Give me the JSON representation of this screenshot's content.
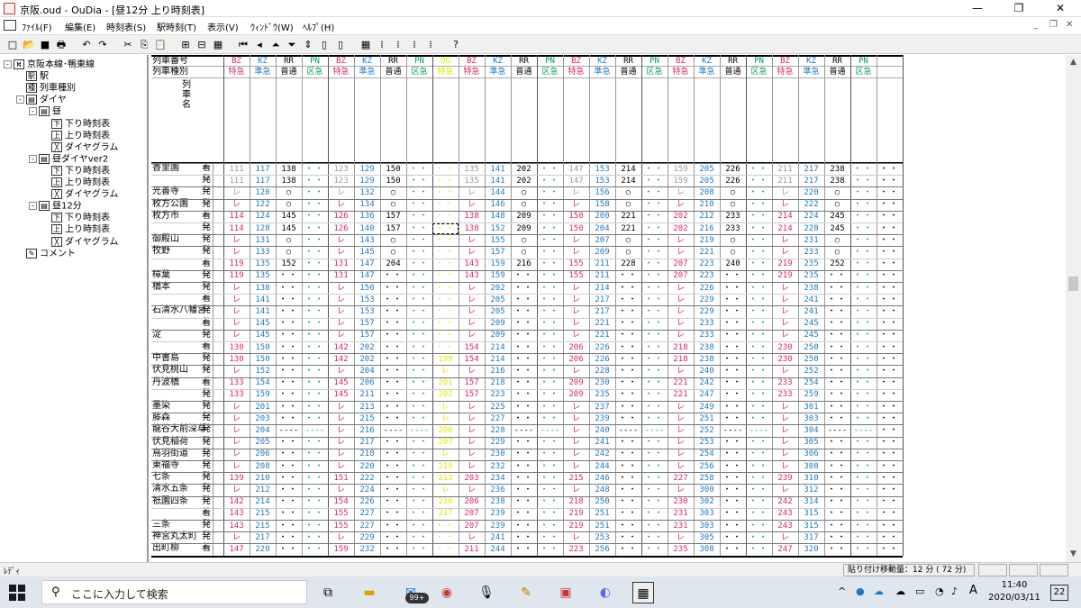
{
  "window": {
    "title": "京阪.oud - OuDia - [昼12分 上り時刻表]",
    "minimize": "—",
    "maximize": "❐",
    "close": "✕"
  },
  "menu": [
    "ﾌｧｲﾙ(F)",
    "編集(E)",
    "時刻表(S)",
    "駅時刻(T)",
    "表示(V)",
    "ｳｨﾝﾄﾞｳ(W)",
    "ﾍﾙﾌﾟ(H)"
  ],
  "mdi_controls": [
    "_",
    "❐",
    "✕"
  ],
  "toolbar_icons": [
    "new-file-icon",
    "open-folder-icon",
    "save-icon",
    "print-icon",
    "undo-icon",
    "redo-icon",
    "cut-icon",
    "copy-icon",
    "paste-icon",
    "insert-train-icon",
    "delete-train-icon",
    "grid-icon",
    "first-icon",
    "prev-icon",
    "time-up-icon",
    "time-down-icon",
    "time-shift-icon",
    "col-left-icon",
    "col-right-icon",
    "timetable-icon",
    "pattern1-icon",
    "pattern2-icon",
    "pattern3-icon",
    "pattern4-icon",
    "help-icon"
  ],
  "tree": [
    {
      "label": "京阪本線･鴨東線",
      "icon": "route-icon",
      "level": 0,
      "exp": "-"
    },
    {
      "label": "駅",
      "icon": "station-icon",
      "level": 1
    },
    {
      "label": "列車種別",
      "icon": "train-type-icon",
      "level": 1
    },
    {
      "label": "ダイヤ",
      "icon": "dia-icon",
      "level": 1,
      "exp": "-"
    },
    {
      "label": "昼",
      "icon": "dia-icon",
      "level": 2,
      "exp": "-"
    },
    {
      "label": "下り時刻表",
      "icon": "down-timetable-icon",
      "level": 3
    },
    {
      "label": "上り時刻表",
      "icon": "up-timetable-icon",
      "level": 3
    },
    {
      "label": "ダイヤグラム",
      "icon": "diagram-icon",
      "level": 3
    },
    {
      "label": "昼ダイヤver2",
      "icon": "dia-icon",
      "level": 2,
      "exp": "-"
    },
    {
      "label": "下り時刻表",
      "icon": "down-timetable-icon",
      "level": 3
    },
    {
      "label": "上り時刻表",
      "icon": "up-timetable-icon",
      "level": 3
    },
    {
      "label": "ダイヤグラム",
      "icon": "diagram-icon",
      "level": 3
    },
    {
      "label": "昼12分",
      "icon": "dia-icon",
      "level": 2,
      "exp": "-"
    },
    {
      "label": "下り時刻表",
      "icon": "down-timetable-icon",
      "level": 3
    },
    {
      "label": "上り時刻表",
      "icon": "up-timetable-icon",
      "level": 3
    },
    {
      "label": "ダイヤグラム",
      "icon": "diagram-icon",
      "level": 3
    },
    {
      "label": "コメント",
      "icon": "comment-icon",
      "level": 1
    }
  ],
  "colors": {
    "BZ": "#e0245e",
    "KZ": "#1e78c8",
    "RR": "#000000",
    "PN": "#00a050",
    "Y": "#e6e600"
  },
  "header": {
    "train_number": "列車番号",
    "train_type": "列車種別",
    "train_name": "列車名"
  },
  "trains": [
    {
      "no": "BZ",
      "type": "特急",
      "c": "BZ"
    },
    {
      "no": "KZ",
      "type": "準急",
      "c": "KZ"
    },
    {
      "no": "RR",
      "type": "普通",
      "c": "RR"
    },
    {
      "no": "PN",
      "type": "区急",
      "c": "PN"
    },
    {
      "no": "BZ",
      "type": "特急",
      "c": "BZ"
    },
    {
      "no": "KZ",
      "type": "準急",
      "c": "KZ"
    },
    {
      "no": "RR",
      "type": "普通",
      "c": "RR"
    },
    {
      "no": "PN",
      "type": "区急",
      "c": "PN"
    },
    {
      "no": "OG",
      "type": "特急",
      "c": "Y"
    },
    {
      "no": "BZ",
      "type": "特急",
      "c": "BZ"
    },
    {
      "no": "KZ",
      "type": "準急",
      "c": "KZ"
    },
    {
      "no": "RR",
      "type": "普通",
      "c": "RR"
    },
    {
      "no": "PN",
      "type": "区急",
      "c": "PN"
    },
    {
      "no": "BZ",
      "type": "特急",
      "c": "BZ"
    },
    {
      "no": "KZ",
      "type": "準急",
      "c": "KZ"
    },
    {
      "no": "RR",
      "type": "普通",
      "c": "RR"
    },
    {
      "no": "PN",
      "type": "区急",
      "c": "PN"
    },
    {
      "no": "BZ",
      "type": "特急",
      "c": "BZ"
    },
    {
      "no": "KZ",
      "type": "準急",
      "c": "KZ"
    },
    {
      "no": "RR",
      "type": "普通",
      "c": "RR"
    },
    {
      "no": "PN",
      "type": "区急",
      "c": "PN"
    },
    {
      "no": "BZ",
      "type": "特急",
      "c": "BZ"
    },
    {
      "no": "KZ",
      "type": "準急",
      "c": "KZ"
    },
    {
      "no": "RR",
      "type": "普通",
      "c": "RR"
    },
    {
      "no": "PN",
      "type": "区急",
      "c": "PN"
    },
    {
      "no": "",
      "type": "",
      "c": "RR"
    }
  ],
  "rows": [
    {
      "st": "香里園",
      "kb": "着",
      "v": [
        "111",
        "117",
        "138",
        "・・",
        "123",
        "129",
        "150",
        "・・",
        "・・",
        "135",
        "141",
        "202",
        "・・",
        "147",
        "153",
        "214",
        "・・",
        "159",
        "205",
        "226",
        "・・",
        "211",
        "217",
        "238",
        "・・",
        "・・"
      ]
    },
    {
      "st": "",
      "kb": "発",
      "v": [
        "111",
        "117",
        "138",
        "・・",
        "123",
        "129",
        "150",
        "・・",
        "・・",
        "135",
        "141",
        "202",
        "・・",
        "147",
        "153",
        "214",
        "・・",
        "159",
        "205",
        "226",
        "・・",
        "211",
        "217",
        "238",
        "・・",
        "・・"
      ]
    },
    {
      "st": "光善寺",
      "kb": "発",
      "v": [
        "レ",
        "120",
        "○",
        "・・",
        "レ",
        "132",
        "○",
        "・・",
        "・・",
        "レ",
        "144",
        "○",
        "・・",
        "レ",
        "156",
        "○",
        "・・",
        "レ",
        "208",
        "○",
        "・・",
        "レ",
        "220",
        "○",
        "・・",
        "・・"
      ]
    },
    {
      "st": "枚方公園",
      "kb": "発",
      "v": [
        "レ",
        "122",
        "○",
        "・・",
        "レ",
        "134",
        "○",
        "・・",
        "・・",
        "レ",
        "146",
        "○",
        "・・",
        "レ",
        "158",
        "○",
        "・・",
        "レ",
        "210",
        "○",
        "・・",
        "レ",
        "222",
        "○",
        "・・",
        "・・"
      ]
    },
    {
      "st": "枚方市",
      "kb": "着",
      "v": [
        "114",
        "124",
        "145",
        "・・",
        "126",
        "136",
        "157",
        "・・",
        "・・",
        "138",
        "148",
        "209",
        "・・",
        "150",
        "200",
        "221",
        "・・",
        "202",
        "212",
        "233",
        "・・",
        "214",
        "224",
        "245",
        "・・",
        "・・"
      ]
    },
    {
      "st": "",
      "kb": "発",
      "v": [
        "114",
        "128",
        "145",
        "・・",
        "126",
        "140",
        "157",
        "・・",
        "・・",
        "138",
        "152",
        "209",
        "・・",
        "150",
        "204",
        "221",
        "・・",
        "202",
        "216",
        "233",
        "・・",
        "214",
        "228",
        "245",
        "・・",
        "・・"
      ]
    },
    {
      "st": "御殿山",
      "kb": "発",
      "v": [
        "レ",
        "131",
        "○",
        "・・",
        "レ",
        "143",
        "○",
        "・・",
        "・・",
        "レ",
        "155",
        "○",
        "・・",
        "レ",
        "207",
        "○",
        "・・",
        "レ",
        "219",
        "○",
        "・・",
        "レ",
        "231",
        "○",
        "・・",
        "・・"
      ]
    },
    {
      "st": "牧野",
      "kb": "発",
      "v": [
        "レ",
        "133",
        "○",
        "・・",
        "レ",
        "145",
        "○",
        "・・",
        "・・",
        "レ",
        "157",
        "○",
        "・・",
        "レ",
        "209",
        "○",
        "・・",
        "レ",
        "221",
        "○",
        "・・",
        "レ",
        "233",
        "○",
        "・・",
        "・・"
      ]
    },
    {
      "st": "",
      "kb": "着",
      "v": [
        "119",
        "135",
        "152",
        "・・",
        "131",
        "147",
        "204",
        "・・",
        "・・",
        "143",
        "159",
        "216",
        "・・",
        "155",
        "211",
        "228",
        "・・",
        "207",
        "223",
        "240",
        "・・",
        "219",
        "235",
        "252",
        "・・",
        "・・"
      ]
    },
    {
      "st": "樟葉",
      "kb": "発",
      "v": [
        "119",
        "135",
        "・・",
        "・・",
        "131",
        "147",
        "・・",
        "・・",
        "・・",
        "143",
        "159",
        "・・",
        "・・",
        "155",
        "211",
        "・・",
        "・・",
        "207",
        "223",
        "・・",
        "・・",
        "219",
        "235",
        "・・",
        "・・",
        "・・"
      ]
    },
    {
      "st": "橋本",
      "kb": "発",
      "v": [
        "レ",
        "138",
        "・・",
        "・・",
        "レ",
        "150",
        "・・",
        "・・",
        "・・",
        "レ",
        "202",
        "・・",
        "・・",
        "レ",
        "214",
        "・・",
        "・・",
        "レ",
        "226",
        "・・",
        "・・",
        "レ",
        "238",
        "・・",
        "・・",
        "・・"
      ]
    },
    {
      "st": "",
      "kb": "着",
      "v": [
        "レ",
        "141",
        "・・",
        "・・",
        "レ",
        "153",
        "・・",
        "・・",
        "・・",
        "レ",
        "205",
        "・・",
        "・・",
        "レ",
        "217",
        "・・",
        "・・",
        "レ",
        "229",
        "・・",
        "・・",
        "レ",
        "241",
        "・・",
        "・・",
        "・・"
      ]
    },
    {
      "st": "石清水八幡宮",
      "kb": "発",
      "v": [
        "レ",
        "141",
        "・・",
        "・・",
        "レ",
        "153",
        "・・",
        "・・",
        "・・",
        "レ",
        "205",
        "・・",
        "・・",
        "レ",
        "217",
        "・・",
        "・・",
        "レ",
        "229",
        "・・",
        "・・",
        "レ",
        "241",
        "・・",
        "・・",
        "・・"
      ]
    },
    {
      "st": "",
      "kb": "着",
      "v": [
        "レ",
        "145",
        "・・",
        "・・",
        "レ",
        "157",
        "・・",
        "・・",
        "・・",
        "レ",
        "209",
        "・・",
        "・・",
        "レ",
        "221",
        "・・",
        "・・",
        "レ",
        "233",
        "・・",
        "・・",
        "レ",
        "245",
        "・・",
        "・・",
        "・・"
      ]
    },
    {
      "st": "淀",
      "kb": "発",
      "v": [
        "レ",
        "145",
        "・・",
        "・・",
        "レ",
        "157",
        "・・",
        "・・",
        "・・",
        "レ",
        "209",
        "・・",
        "・・",
        "レ",
        "221",
        "・・",
        "・・",
        "レ",
        "233",
        "・・",
        "・・",
        "レ",
        "245",
        "・・",
        "・・",
        "・・"
      ]
    },
    {
      "st": "",
      "kb": "着",
      "v": [
        "130",
        "150",
        "・・",
        "・・",
        "142",
        "202",
        "・・",
        "・・",
        "・・",
        "154",
        "214",
        "・・",
        "・・",
        "206",
        "226",
        "・・",
        "・・",
        "218",
        "238",
        "・・",
        "・・",
        "230",
        "250",
        "・・",
        "・・",
        "・・"
      ]
    },
    {
      "st": "中書島",
      "kb": "発",
      "v": [
        "130",
        "150",
        "・・",
        "・・",
        "142",
        "202",
        "・・",
        "・・",
        "199",
        "154",
        "214",
        "・・",
        "・・",
        "206",
        "226",
        "・・",
        "・・",
        "218",
        "238",
        "・・",
        "・・",
        "230",
        "250",
        "・・",
        "・・",
        "・・"
      ]
    },
    {
      "st": "伏見桃山",
      "kb": "発",
      "v": [
        "レ",
        "152",
        "・・",
        "・・",
        "レ",
        "204",
        "・・",
        "・・",
        "レ",
        "レ",
        "216",
        "・・",
        "・・",
        "レ",
        "228",
        "・・",
        "・・",
        "レ",
        "240",
        "・・",
        "・・",
        "レ",
        "252",
        "・・",
        "・・",
        "・・"
      ]
    },
    {
      "st": "丹波橋",
      "kb": "着",
      "v": [
        "133",
        "154",
        "・・",
        "・・",
        "145",
        "206",
        "・・",
        "・・",
        "201",
        "157",
        "218",
        "・・",
        "・・",
        "209",
        "230",
        "・・",
        "・・",
        "221",
        "242",
        "・・",
        "・・",
        "233",
        "254",
        "・・",
        "・・",
        "・・"
      ]
    },
    {
      "st": "",
      "kb": "発",
      "v": [
        "133",
        "159",
        "・・",
        "・・",
        "145",
        "211",
        "・・",
        "・・",
        "202",
        "157",
        "223",
        "・・",
        "・・",
        "209",
        "235",
        "・・",
        "・・",
        "221",
        "247",
        "・・",
        "・・",
        "233",
        "259",
        "・・",
        "・・",
        "・・"
      ]
    },
    {
      "st": "墨染",
      "kb": "発",
      "v": [
        "レ",
        "201",
        "・・",
        "・・",
        "レ",
        "213",
        "・・",
        "・・",
        "レ",
        "レ",
        "225",
        "・・",
        "・・",
        "レ",
        "237",
        "・・",
        "・・",
        "レ",
        "249",
        "・・",
        "・・",
        "レ",
        "301",
        "・・",
        "・・",
        "・・"
      ]
    },
    {
      "st": "藤森",
      "kb": "発",
      "v": [
        "レ",
        "203",
        "・・",
        "・・",
        "レ",
        "215",
        "・・",
        "・・",
        "レ",
        "レ",
        "227",
        "・・",
        "・・",
        "レ",
        "239",
        "・・",
        "・・",
        "レ",
        "251",
        "・・",
        "・・",
        "レ",
        "303",
        "・・",
        "・・",
        "・・"
      ]
    },
    {
      "st": "龍谷大前深草",
      "kb": "発",
      "v": [
        "レ",
        "204",
        "----",
        "----",
        "レ",
        "216",
        "----",
        "----",
        "206",
        "レ",
        "228",
        "----",
        "----",
        "レ",
        "240",
        "----",
        "----",
        "レ",
        "252",
        "----",
        "----",
        "レ",
        "304",
        "----",
        "----",
        "・・"
      ]
    },
    {
      "st": "伏見稲荷",
      "kb": "発",
      "v": [
        "レ",
        "205",
        "・・",
        "・・",
        "レ",
        "217",
        "・・",
        "・・",
        "207",
        "レ",
        "229",
        "・・",
        "・・",
        "レ",
        "241",
        "・・",
        "・・",
        "レ",
        "253",
        "・・",
        "・・",
        "レ",
        "305",
        "・・",
        "・・",
        "・・"
      ]
    },
    {
      "st": "鳥羽街道",
      "kb": "発",
      "v": [
        "レ",
        "206",
        "・・",
        "・・",
        "レ",
        "218",
        "・・",
        "・・",
        "レ",
        "レ",
        "230",
        "・・",
        "・・",
        "レ",
        "242",
        "・・",
        "・・",
        "レ",
        "254",
        "・・",
        "・・",
        "レ",
        "306",
        "・・",
        "・・",
        "・・"
      ]
    },
    {
      "st": "東福寺",
      "kb": "発",
      "v": [
        "レ",
        "208",
        "・・",
        "・・",
        "レ",
        "220",
        "・・",
        "・・",
        "210",
        "レ",
        "232",
        "・・",
        "・・",
        "レ",
        "244",
        "・・",
        "・・",
        "レ",
        "256",
        "・・",
        "・・",
        "レ",
        "308",
        "・・",
        "・・",
        "・・"
      ]
    },
    {
      "st": "七条",
      "kb": "発",
      "v": [
        "139",
        "210",
        "・・",
        "・・",
        "151",
        "222",
        "・・",
        "・・",
        "213",
        "203",
        "234",
        "・・",
        "・・",
        "215",
        "246",
        "・・",
        "・・",
        "227",
        "258",
        "・・",
        "・・",
        "239",
        "310",
        "・・",
        "・・",
        "・・"
      ]
    },
    {
      "st": "清水五条",
      "kb": "発",
      "v": [
        "レ",
        "212",
        "・・",
        "・・",
        "レ",
        "224",
        "・・",
        "・・",
        "レ",
        "レ",
        "236",
        "・・",
        "・・",
        "レ",
        "248",
        "・・",
        "・・",
        "レ",
        "300",
        "・・",
        "・・",
        "レ",
        "312",
        "・・",
        "・・",
        "・・"
      ]
    },
    {
      "st": "祇園四条",
      "kb": "発",
      "v": [
        "142",
        "214",
        "・・",
        "・・",
        "154",
        "226",
        "・・",
        "・・",
        "216",
        "206",
        "238",
        "・・",
        "・・",
        "218",
        "250",
        "・・",
        "・・",
        "230",
        "302",
        "・・",
        "・・",
        "242",
        "314",
        "・・",
        "・・",
        "・・"
      ]
    },
    {
      "st": "",
      "kb": "着",
      "v": [
        "143",
        "215",
        "・・",
        "・・",
        "155",
        "227",
        "・・",
        "・・",
        "217",
        "207",
        "239",
        "・・",
        "・・",
        "219",
        "251",
        "・・",
        "・・",
        "231",
        "303",
        "・・",
        "・・",
        "243",
        "315",
        "・・",
        "・・",
        "・・"
      ]
    },
    {
      "st": "三条",
      "kb": "発",
      "v": [
        "143",
        "215",
        "・・",
        "・・",
        "155",
        "227",
        "・・",
        "・・",
        "・・",
        "207",
        "239",
        "・・",
        "・・",
        "219",
        "251",
        "・・",
        "・・",
        "231",
        "303",
        "・・",
        "・・",
        "243",
        "315",
        "・・",
        "・・",
        "・・"
      ]
    },
    {
      "st": "神宮丸太町",
      "kb": "発",
      "v": [
        "レ",
        "217",
        "・・",
        "・・",
        "レ",
        "229",
        "・・",
        "・・",
        "・・",
        "レ",
        "241",
        "・・",
        "・・",
        "レ",
        "253",
        "・・",
        "・・",
        "レ",
        "305",
        "・・",
        "・・",
        "レ",
        "317",
        "・・",
        "・・",
        "・・"
      ]
    },
    {
      "st": "出町柳",
      "kb": "着",
      "v": [
        "147",
        "220",
        "・・",
        "・・",
        "159",
        "232",
        "・・",
        "・・",
        "・・",
        "211",
        "244",
        "・・",
        "・・",
        "223",
        "256",
        "・・",
        "・・",
        "235",
        "308",
        "・・",
        "・・",
        "247",
        "320",
        "・・",
        "・・",
        "・・"
      ]
    }
  ],
  "status": {
    "left": "ﾚﾃﾞｨ",
    "paste": "貼り付け移動量：12 分 ( 72 分)"
  },
  "taskbar": {
    "search_placeholder": "ここに入力して検索",
    "badge": "99+",
    "time": "11:40",
    "date": "2020/03/11",
    "notif": "22",
    "ime": "A"
  }
}
